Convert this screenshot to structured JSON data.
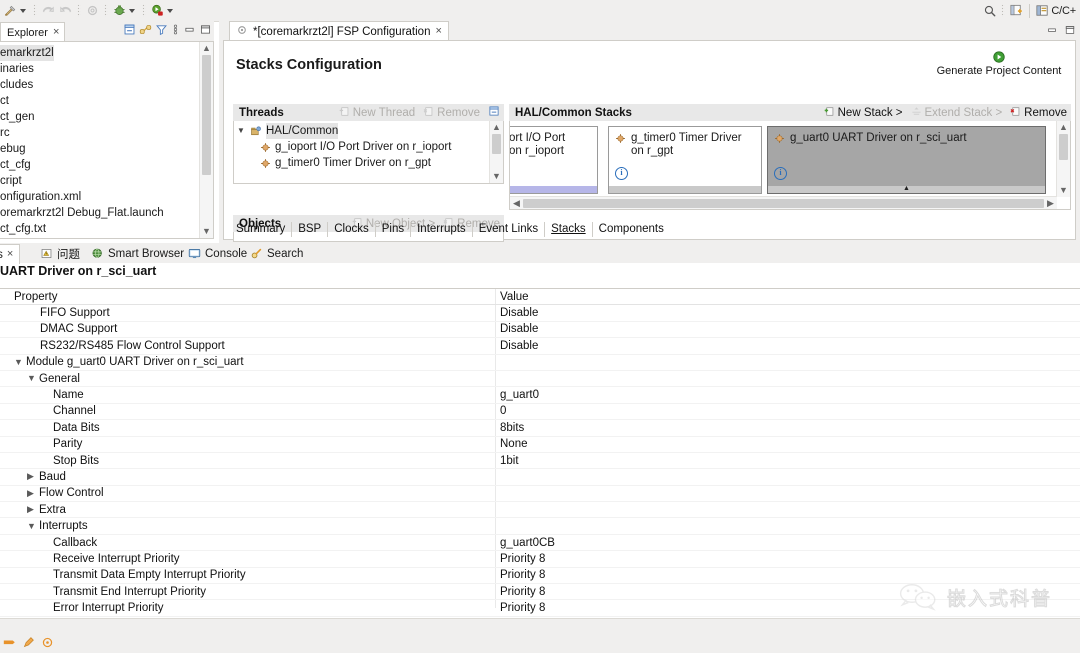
{
  "toolbar": {
    "icons": [
      "build-hammer-icon",
      "dropdown-caret",
      "undo-icon",
      "redo-icon",
      "settings-gear-icon",
      "debug-bug-icon",
      "dropdown-caret",
      "run-icon",
      "dropdown-caret"
    ],
    "search_icon": "search-icon",
    "perspective_new_icon": "new-perspective-icon",
    "perspective_label": "C/C+",
    "perspective_icon": "cdt-perspective-icon"
  },
  "explorer": {
    "tab_label": "Explorer",
    "tab_close": "×",
    "tools": [
      "collapse-all-icon",
      "link-with-editor-icon",
      "filter-icon",
      "view-menu-icon",
      "minimize-icon",
      "maximize-icon"
    ],
    "tree": [
      {
        "label": "emarkrzt2l",
        "selected": true
      },
      {
        "label": "inaries",
        "selected": false
      },
      {
        "label": "cludes",
        "selected": false
      },
      {
        "label": "ct",
        "selected": false
      },
      {
        "label": "ct_gen",
        "selected": false
      },
      {
        "label": "rc",
        "selected": false
      },
      {
        "label": "ebug",
        "selected": false
      },
      {
        "label": "ct_cfg",
        "selected": false
      },
      {
        "label": "cript",
        "selected": false
      },
      {
        "label": "onfiguration.xml",
        "selected": false
      },
      {
        "label": "oremarkrzt2l Debug_Flat.launch",
        "selected": false
      },
      {
        "label": "ct_cfg.txt",
        "selected": false
      }
    ],
    "scroll_up": "ⱏ",
    "scroll_down": "ⱟ"
  },
  "editor": {
    "tab_label": "*[coremarkrzt2l] FSP Configuration",
    "tab_icon": "fsp-configuration-icon",
    "tab_close": "×",
    "minimize_icon": "minimize-icon",
    "maximize_icon": "maximize-icon",
    "page_title": "Stacks Configuration",
    "generate_button": {
      "label": "Generate Project Content",
      "icon": "generate-play-icon"
    },
    "threads_panel": {
      "title": "Threads",
      "actions": [
        {
          "label": "New Thread",
          "enabled": false,
          "icon": "new-thread-icon"
        },
        {
          "label": "Remove",
          "enabled": false,
          "icon": "remove-icon"
        }
      ],
      "collapse_icon": "collapse-all-icon",
      "tree": [
        {
          "label": "HAL/Common",
          "indent": 0,
          "expanded": true,
          "selected": true,
          "icon": "hal-common-icon"
        },
        {
          "label": "g_ioport I/O Port Driver on r_ioport",
          "indent": 1,
          "selected": false,
          "icon": "module-icon"
        },
        {
          "label": "g_timer0 Timer Driver on r_gpt",
          "indent": 1,
          "selected": false,
          "icon": "module-icon"
        }
      ]
    },
    "objects_panel": {
      "title": "Objects",
      "actions": [
        {
          "label": "New Object >",
          "enabled": false,
          "icon": "new-object-icon"
        },
        {
          "label": "Remove",
          "enabled": false,
          "icon": "remove-icon"
        }
      ]
    },
    "stacks_panel": {
      "title": "HAL/Common Stacks",
      "actions": [
        {
          "label": "New Stack >",
          "enabled": true,
          "icon": "new-stack-icon"
        },
        {
          "label": "Extend Stack >",
          "enabled": false,
          "icon": "extend-stack-icon"
        },
        {
          "label": "Remove",
          "enabled": true,
          "icon": "remove-icon"
        }
      ],
      "stacks": [
        {
          "label": "ort I/O Port\non r_ioport",
          "selected": false,
          "clipped": true,
          "footer": "lavender",
          "info": false
        },
        {
          "label": "g_timer0 Timer Driver on r_gpt",
          "selected": false,
          "clipped": false,
          "footer": "gray",
          "info": true,
          "icon": "module-icon"
        },
        {
          "label": "g_uart0 UART Driver on r_sci_uart",
          "selected": true,
          "clipped": false,
          "footer": "gray",
          "info": true,
          "icon": "module-icon"
        }
      ]
    },
    "config_tabs": [
      {
        "label": "Summary",
        "active": false
      },
      {
        "label": "BSP",
        "active": false
      },
      {
        "label": "Clocks",
        "active": false
      },
      {
        "label": "Pins",
        "active": false
      },
      {
        "label": "Interrupts",
        "active": false
      },
      {
        "label": "Event Links",
        "active": false
      },
      {
        "label": "Stacks",
        "active": true
      },
      {
        "label": "Components",
        "active": false
      }
    ]
  },
  "bottom_view": {
    "tabs": [
      {
        "label": "ties",
        "active": true,
        "close": "×",
        "icon": "properties-icon"
      },
      {
        "label": "问题",
        "active": false,
        "icon": "problems-icon"
      },
      {
        "label": "Smart Browser",
        "active": false,
        "icon": "smart-browser-icon"
      },
      {
        "label": "Console",
        "active": false,
        "icon": "console-icon"
      },
      {
        "label": "Search",
        "active": false,
        "icon": "search-tab-icon"
      }
    ],
    "title": "UART Driver on r_sci_uart",
    "columns": [
      "Property",
      "Value"
    ],
    "rows": [
      {
        "name": "FIFO Support",
        "value": "Disable",
        "indent": 2,
        "twisty": ""
      },
      {
        "name": "DMAC Support",
        "value": "Disable",
        "indent": 2,
        "twisty": ""
      },
      {
        "name": "RS232/RS485 Flow Control Support",
        "value": "Disable",
        "indent": 2,
        "twisty": ""
      },
      {
        "name": "Module g_uart0 UART Driver on r_sci_uart",
        "value": "",
        "indent": 1,
        "twisty": "expanded"
      },
      {
        "name": "General",
        "value": "",
        "indent": 2,
        "twisty": "expanded"
      },
      {
        "name": "Name",
        "value": "g_uart0",
        "indent": 3,
        "twisty": ""
      },
      {
        "name": "Channel",
        "value": "0",
        "indent": 3,
        "twisty": ""
      },
      {
        "name": "Data Bits",
        "value": "8bits",
        "indent": 3,
        "twisty": ""
      },
      {
        "name": "Parity",
        "value": "None",
        "indent": 3,
        "twisty": ""
      },
      {
        "name": "Stop Bits",
        "value": "1bit",
        "indent": 3,
        "twisty": ""
      },
      {
        "name": "Baud",
        "value": "",
        "indent": 2,
        "twisty": "collapsed"
      },
      {
        "name": "Flow Control",
        "value": "",
        "indent": 2,
        "twisty": "collapsed"
      },
      {
        "name": "Extra",
        "value": "",
        "indent": 2,
        "twisty": "collapsed"
      },
      {
        "name": "Interrupts",
        "value": "",
        "indent": 2,
        "twisty": "expanded"
      },
      {
        "name": "Callback",
        "value": "g_uart0CB",
        "indent": 3,
        "twisty": ""
      },
      {
        "name": "Receive Interrupt Priority",
        "value": "Priority 8",
        "indent": 3,
        "twisty": ""
      },
      {
        "name": "Transmit Data Empty Interrupt Priority",
        "value": "Priority 8",
        "indent": 3,
        "twisty": ""
      },
      {
        "name": "Transmit End Interrupt Priority",
        "value": "Priority 8",
        "indent": 3,
        "twisty": ""
      },
      {
        "name": "Error Interrupt Priority",
        "value": "Priority 8",
        "indent": 3,
        "twisty": ""
      }
    ]
  },
  "status_bar": {
    "icons": [
      "writable-icon",
      "insert-mode-icon",
      "build-status-icon"
    ]
  },
  "watermark": {
    "icon": "wechat-icon",
    "text": "嵌入式科普"
  },
  "colors": {
    "chrome": "#f0efee",
    "border": "#cfcdc8",
    "panel_header": "#e8e8e8",
    "selection": "#e4e4e4",
    "stack_selected": "#a6a6a6",
    "info_blue": "#2a6ebb",
    "accent_orange": "#e8922a"
  }
}
